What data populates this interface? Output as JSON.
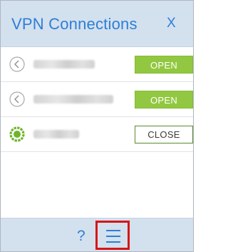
{
  "window": {
    "title": "VPN Connections",
    "close_label": "X"
  },
  "connections": [
    {
      "name": "▒▒▒▒▒▒▒",
      "status": "disconnected",
      "status_icon": "chevron-left-circle-icon",
      "button_label": "OPEN"
    },
    {
      "name": "▒▒▒▒▒▒▒▒▒▒",
      "status": "disconnected",
      "status_icon": "chevron-left-circle-icon",
      "button_label": "OPEN"
    },
    {
      "name": "▒▒▒▒▒",
      "status": "connected",
      "status_icon": "connected-status-icon",
      "button_label": "CLOSE"
    }
  ],
  "footer": {
    "help_label": "?",
    "menu_icon": "hamburger-menu-icon"
  },
  "colors": {
    "accent": "#2d7fd6",
    "header_bg": "#d3e0ee",
    "open_button": "#92c841",
    "connected": "#6fb52c",
    "highlight": "#d51616"
  }
}
